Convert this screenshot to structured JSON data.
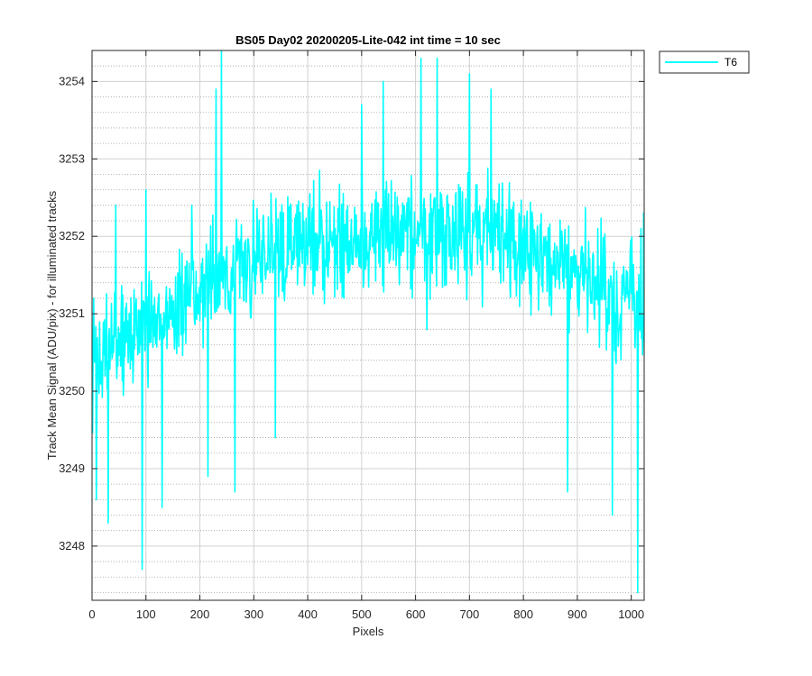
{
  "chart_data": {
    "type": "line",
    "title": "BS05 Day02 20200205-Lite-042 int time = 10 sec",
    "xlabel": "Pixels",
    "ylabel": "Track Mean Signal (ADU/pix) - for illuminated tracks",
    "xlim": [
      0,
      1024
    ],
    "ylim": [
      3247.3,
      3254.4
    ],
    "xticks": [
      0,
      100,
      200,
      300,
      400,
      500,
      600,
      700,
      800,
      900,
      1000
    ],
    "yticks": [
      3248,
      3249,
      3250,
      3251,
      3252,
      3253,
      3254
    ],
    "grid": true,
    "minor_grid": true,
    "legend_position": "outside-top-right",
    "series": [
      {
        "name": "T6",
        "color": "#00ffff",
        "x_start": 1,
        "x_end": 1024,
        "x_step": 1,
        "noise_seed": 42,
        "trend": [
          [
            1,
            3250.2
          ],
          [
            50,
            3250.6
          ],
          [
            100,
            3250.8
          ],
          [
            150,
            3251.0
          ],
          [
            200,
            3251.3
          ],
          [
            250,
            3251.5
          ],
          [
            300,
            3251.7
          ],
          [
            350,
            3251.8
          ],
          [
            400,
            3251.9
          ],
          [
            450,
            3251.95
          ],
          [
            500,
            3252.0
          ],
          [
            550,
            3251.95
          ],
          [
            600,
            3252.0
          ],
          [
            650,
            3252.0
          ],
          [
            700,
            3252.0
          ],
          [
            750,
            3251.95
          ],
          [
            800,
            3251.85
          ],
          [
            850,
            3251.7
          ],
          [
            900,
            3251.5
          ],
          [
            950,
            3251.3
          ],
          [
            1000,
            3251.1
          ],
          [
            1024,
            3251.0
          ]
        ],
        "noise_amplitude": 0.85,
        "spikes": [
          [
            3,
            3251.2
          ],
          [
            8,
            3248.6
          ],
          [
            30,
            3248.3
          ],
          [
            44,
            3252.4
          ],
          [
            93,
            3247.7
          ],
          [
            100,
            3252.6
          ],
          [
            130,
            3248.5
          ],
          [
            185,
            3252.4
          ],
          [
            215,
            3248.9
          ],
          [
            230,
            3253.9
          ],
          [
            240,
            3254.4
          ],
          [
            265,
            3248.7
          ],
          [
            340,
            3249.4
          ],
          [
            500,
            3253.7
          ],
          [
            540,
            3254.0
          ],
          [
            610,
            3254.3
          ],
          [
            640,
            3254.3
          ],
          [
            700,
            3254.1
          ],
          [
            740,
            3253.9
          ],
          [
            882,
            3248.7
          ],
          [
            965,
            3248.4
          ],
          [
            1012,
            3247.4
          ],
          [
            1018,
            3252.1
          ],
          [
            1023,
            3252.3
          ]
        ]
      }
    ]
  }
}
